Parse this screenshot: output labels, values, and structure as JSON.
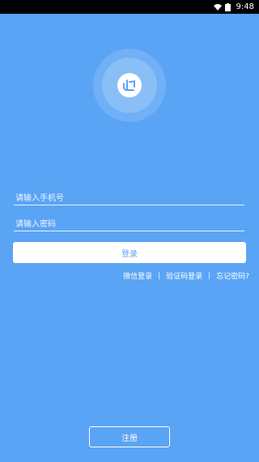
{
  "status_bar": {
    "time": "9:48",
    "icons": [
      "wifi-icon",
      "battery-icon"
    ]
  },
  "logo": {
    "icon": "heart-app-logo-icon"
  },
  "form": {
    "phone_placeholder": "请输入手机号",
    "phone_value": "",
    "password_placeholder": "请输入密码",
    "password_value": ""
  },
  "login_button": "登录",
  "links": {
    "wechat": "微信登录",
    "separator": "|",
    "sms_code": "验证码登录",
    "forgot": "忘记密码?"
  },
  "register_button": "注册",
  "colors": {
    "background": "#5aa4f5",
    "button": "#ffffff"
  }
}
